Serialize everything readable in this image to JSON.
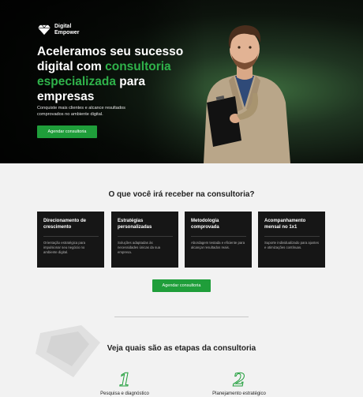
{
  "brand": {
    "line1": "Digital",
    "line2": "Empower"
  },
  "hero": {
    "headline_1": "Aceleramos seu sucesso digital com ",
    "headline_green": "consultoria especializada",
    "headline_2": " para empresas",
    "subtitle": "Conquiste mais clientes e alcance resultados comprovados no ambiente digital.",
    "cta": "Agendar consultoria"
  },
  "benefits": {
    "title": "O que você irá receber na consultoria?",
    "cards": [
      {
        "title": "Direcionamento de crescimento",
        "desc": "Orientação estratégica para impulsionar seu negócio no ambiente digital."
      },
      {
        "title": "Estratégias personalizadas",
        "desc": "Soluções adaptadas às necessidades únicas da sua empresa."
      },
      {
        "title": "Metodologia comprovada",
        "desc": "Abordagem testada e eficiente para alcançar resultados reais."
      },
      {
        "title": "Acompanhamento mensal no 1x1",
        "desc": "Suporte individualizado para ajustes e otimizações contínuas."
      }
    ],
    "cta": "Agendar consultoria"
  },
  "steps": {
    "title": "Veja quais são as etapas da consultoria",
    "items": [
      {
        "num": "1",
        "label": "Pesquisa e diagnóstico"
      },
      {
        "num": "2",
        "label": "Planejamento estratégico"
      }
    ]
  },
  "colors": {
    "accent": "#1f9e3a",
    "card_bg": "#161616",
    "page_bg": "#f2f2f2"
  }
}
